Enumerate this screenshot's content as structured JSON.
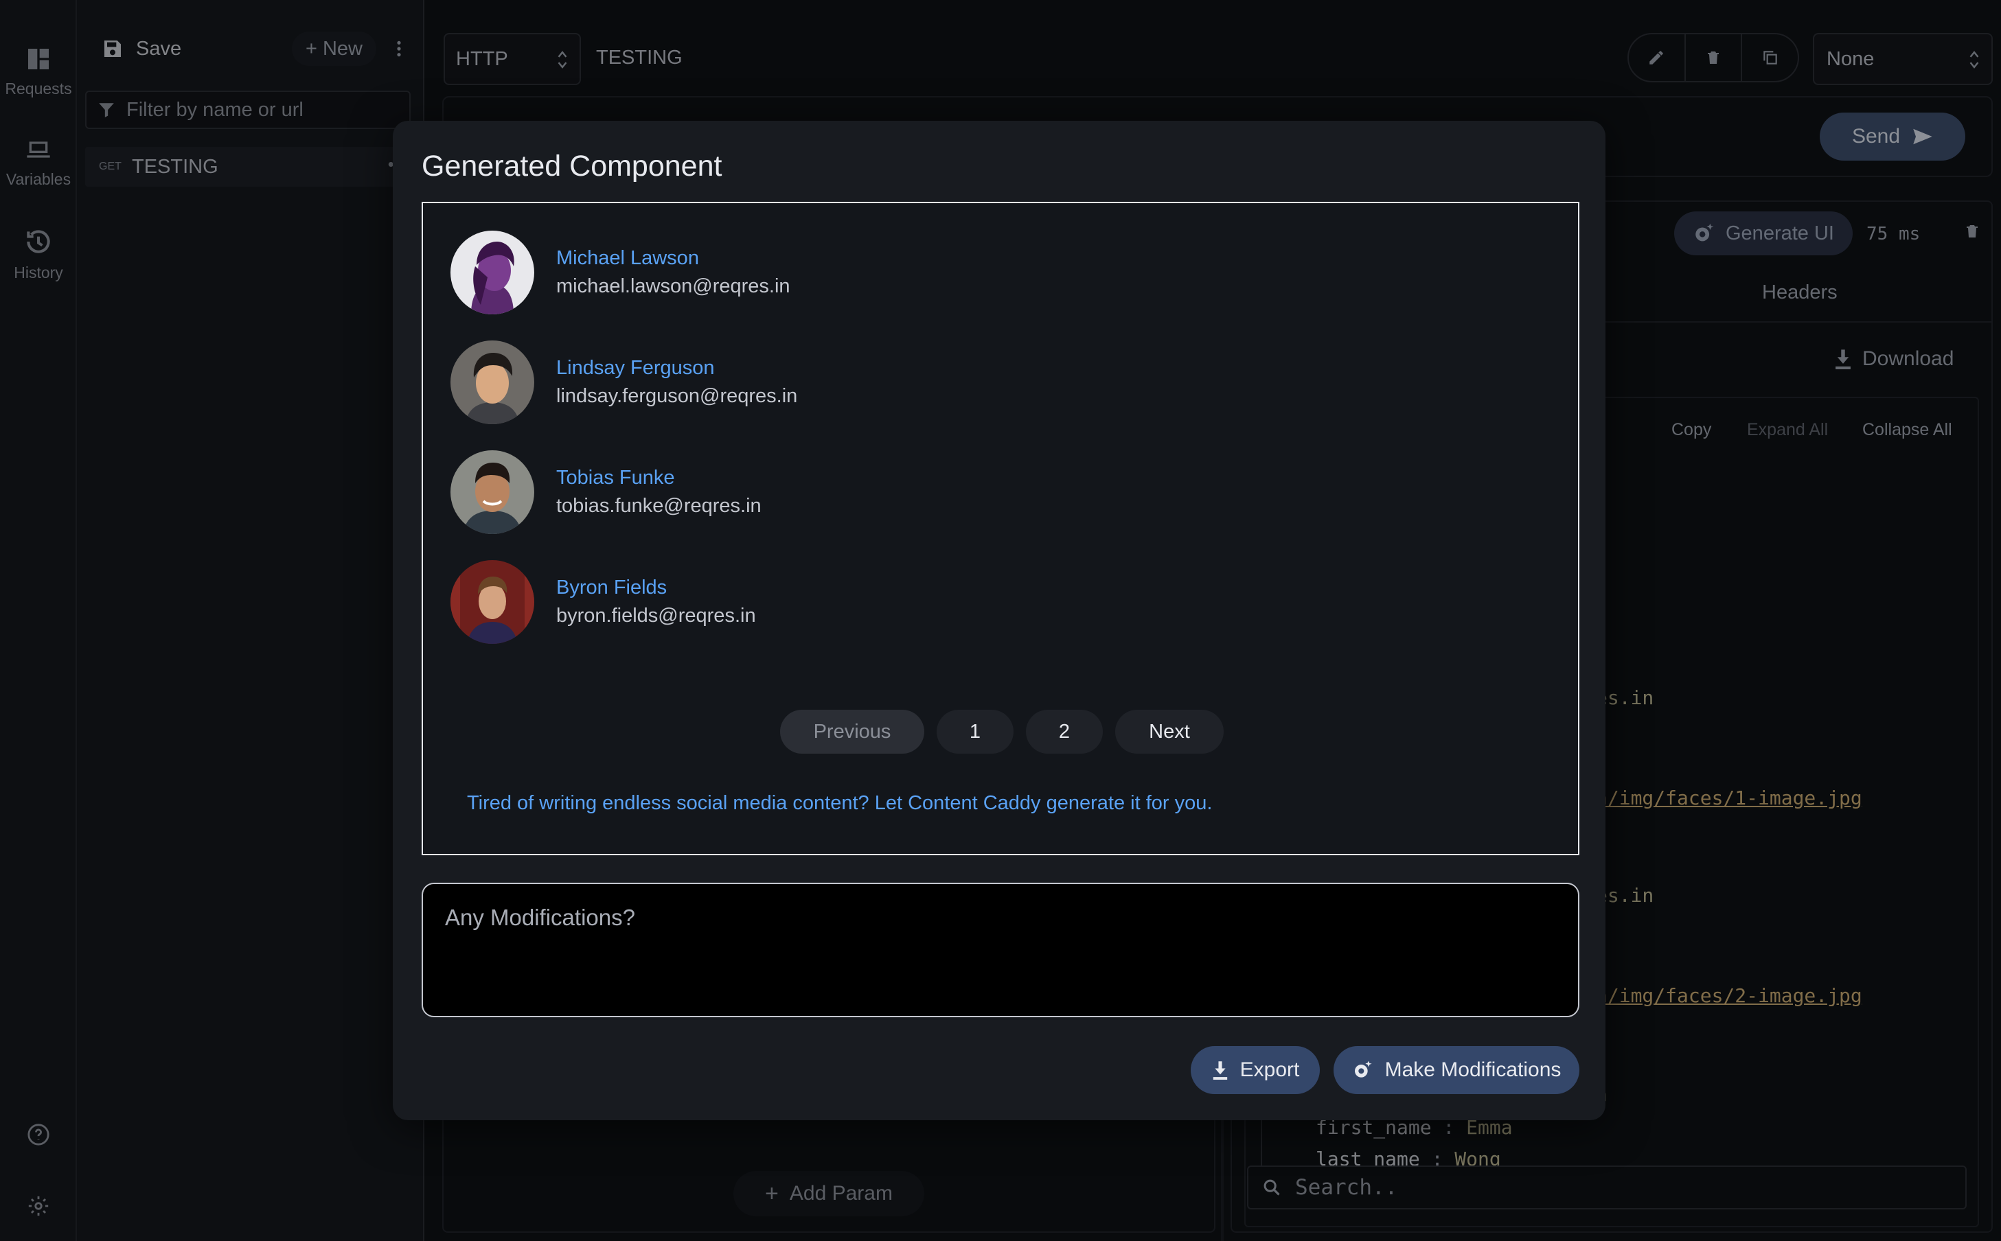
{
  "rail": {
    "requests": "Requests",
    "variables": "Variables",
    "history": "History"
  },
  "sidebar": {
    "save_label": "Save",
    "new_label": "+ New",
    "filter_placeholder": "Filter by name or url",
    "requests": [
      {
        "method": "GET",
        "name": "TESTING"
      }
    ]
  },
  "request": {
    "protocol": "HTTP",
    "name": "TESTING",
    "environment": "None",
    "send_label": "Send",
    "add_param_label": "Add Param"
  },
  "response": {
    "generate_ui_label": "Generate UI",
    "time": "75 ms",
    "headers_tab": "Headers",
    "download_label": "Download",
    "copy_label": "Copy",
    "expand_label": "Expand All",
    "collapse_label": "Collapse All",
    "fragments": [
      "es.in",
      "n/img/faces/1-image.jpg",
      "es.in",
      "n/img/faces/2-image.jpg",
      "n"
    ],
    "first_name_key": "first_name",
    "first_name_val": "Emma",
    "last_name_key": "last_name",
    "last_name_val": "Wong",
    "search_placeholder": "Search.."
  },
  "modal": {
    "title": "Generated Component",
    "users": [
      {
        "name": "Michael Lawson",
        "email": "michael.lawson@reqres.in"
      },
      {
        "name": "Lindsay Ferguson",
        "email": "lindsay.ferguson@reqres.in"
      },
      {
        "name": "Tobias Funke",
        "email": "tobias.funke@reqres.in"
      },
      {
        "name": "Byron Fields",
        "email": "byron.fields@reqres.in"
      }
    ],
    "pager": {
      "previous": "Previous",
      "page1": "1",
      "page2": "2",
      "next": "Next"
    },
    "promo": "Tired of writing endless social media content? Let Content Caddy generate it for you.",
    "modifications_placeholder": "Any Modifications?",
    "export_label": "Export",
    "make_mods_label": "Make Modifications"
  },
  "colors": {
    "accent_link": "#5aa2f5",
    "button_bg": "#34476a",
    "background": "#0f1115"
  }
}
